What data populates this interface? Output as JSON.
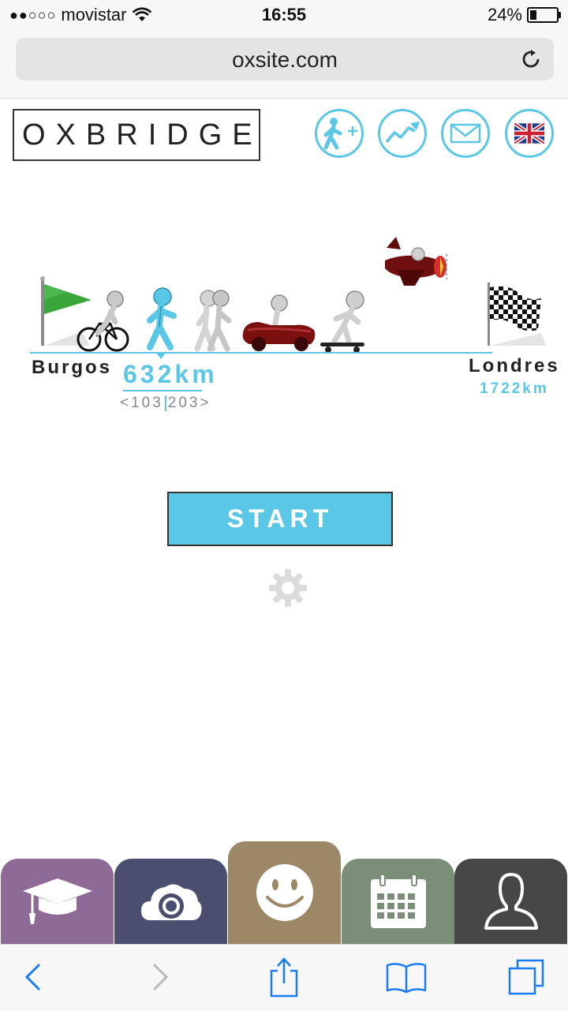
{
  "status_bar": {
    "signal": "●●○○○",
    "carrier": "movistar",
    "time": "16:55",
    "battery_percent_text": "24%",
    "battery_level": 0.24
  },
  "browser": {
    "url": "oxsite.com"
  },
  "header": {
    "logo": "OXBRIDGE",
    "icons": [
      "add-person-icon",
      "trending-icon",
      "mail-icon",
      "uk-flag-icon"
    ]
  },
  "race": {
    "start_label": "Burgos",
    "end_label": "Londres",
    "end_distance": "1722km",
    "current_distance": "632km",
    "range_left": "<103",
    "range_right": "203>",
    "colors": {
      "accent": "#5bc7e6",
      "muted": "#888888"
    }
  },
  "actions": {
    "start_label": "START"
  },
  "tabs": [
    {
      "name": "graduation-cap-icon",
      "color": "#8e6a96"
    },
    {
      "name": "cloud-camera-icon",
      "color": "#4a4f70"
    },
    {
      "name": "smiley-icon",
      "color": "#9c8766"
    },
    {
      "name": "calendar-icon",
      "color": "#7b8f78"
    },
    {
      "name": "user-icon",
      "color": "#474747"
    }
  ],
  "toolbar": {
    "icons": [
      "back-icon",
      "forward-icon",
      "share-icon",
      "bookmarks-icon",
      "tabs-icon"
    ]
  }
}
